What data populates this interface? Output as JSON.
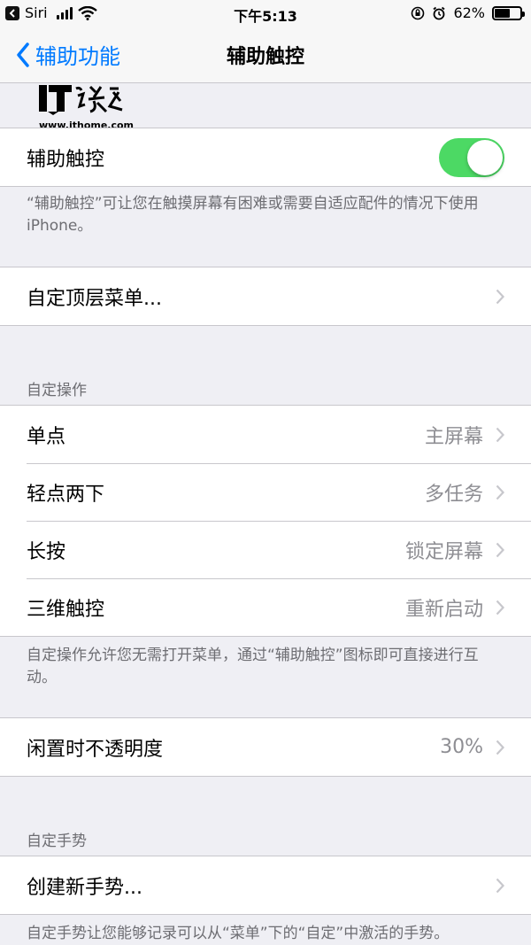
{
  "status_bar": {
    "carrier": "Siri",
    "time": "下午5:13",
    "battery": "62%",
    "battery_level": 0.62
  },
  "nav": {
    "back_label": "辅助功能",
    "title": "辅助触控"
  },
  "watermark": {
    "logo_text": "IT之家",
    "url": "www.ithome.com"
  },
  "toggle_row": {
    "label": "辅助触控",
    "enabled": true
  },
  "toggle_footnote": "“辅助触控”可让您在触摸屏幕有困难或需要自适应配件的情况下使用 iPhone。",
  "custom_menu": {
    "label": "自定顶层菜单..."
  },
  "custom_actions": {
    "header": "自定操作",
    "rows": [
      {
        "label": "单点",
        "value": "主屏幕"
      },
      {
        "label": "轻点两下",
        "value": "多任务"
      },
      {
        "label": "长按",
        "value": "锁定屏幕"
      },
      {
        "label": "三维触控",
        "value": "重新启动"
      }
    ],
    "footnote": "自定操作允许您无需打开菜单，通过“辅助触控”图标即可直接进行互动。"
  },
  "idle_opacity": {
    "label": "闲置时不透明度",
    "value": "30%"
  },
  "custom_gestures": {
    "header": "自定手势",
    "create_label": "创建新手势...",
    "footnote": "自定手势让您能够记录可以从“菜单”下的“自定”中激活的手势。"
  },
  "colors": {
    "accent": "#007aff",
    "toggle_on": "#4cd964",
    "background": "#efeff4"
  }
}
